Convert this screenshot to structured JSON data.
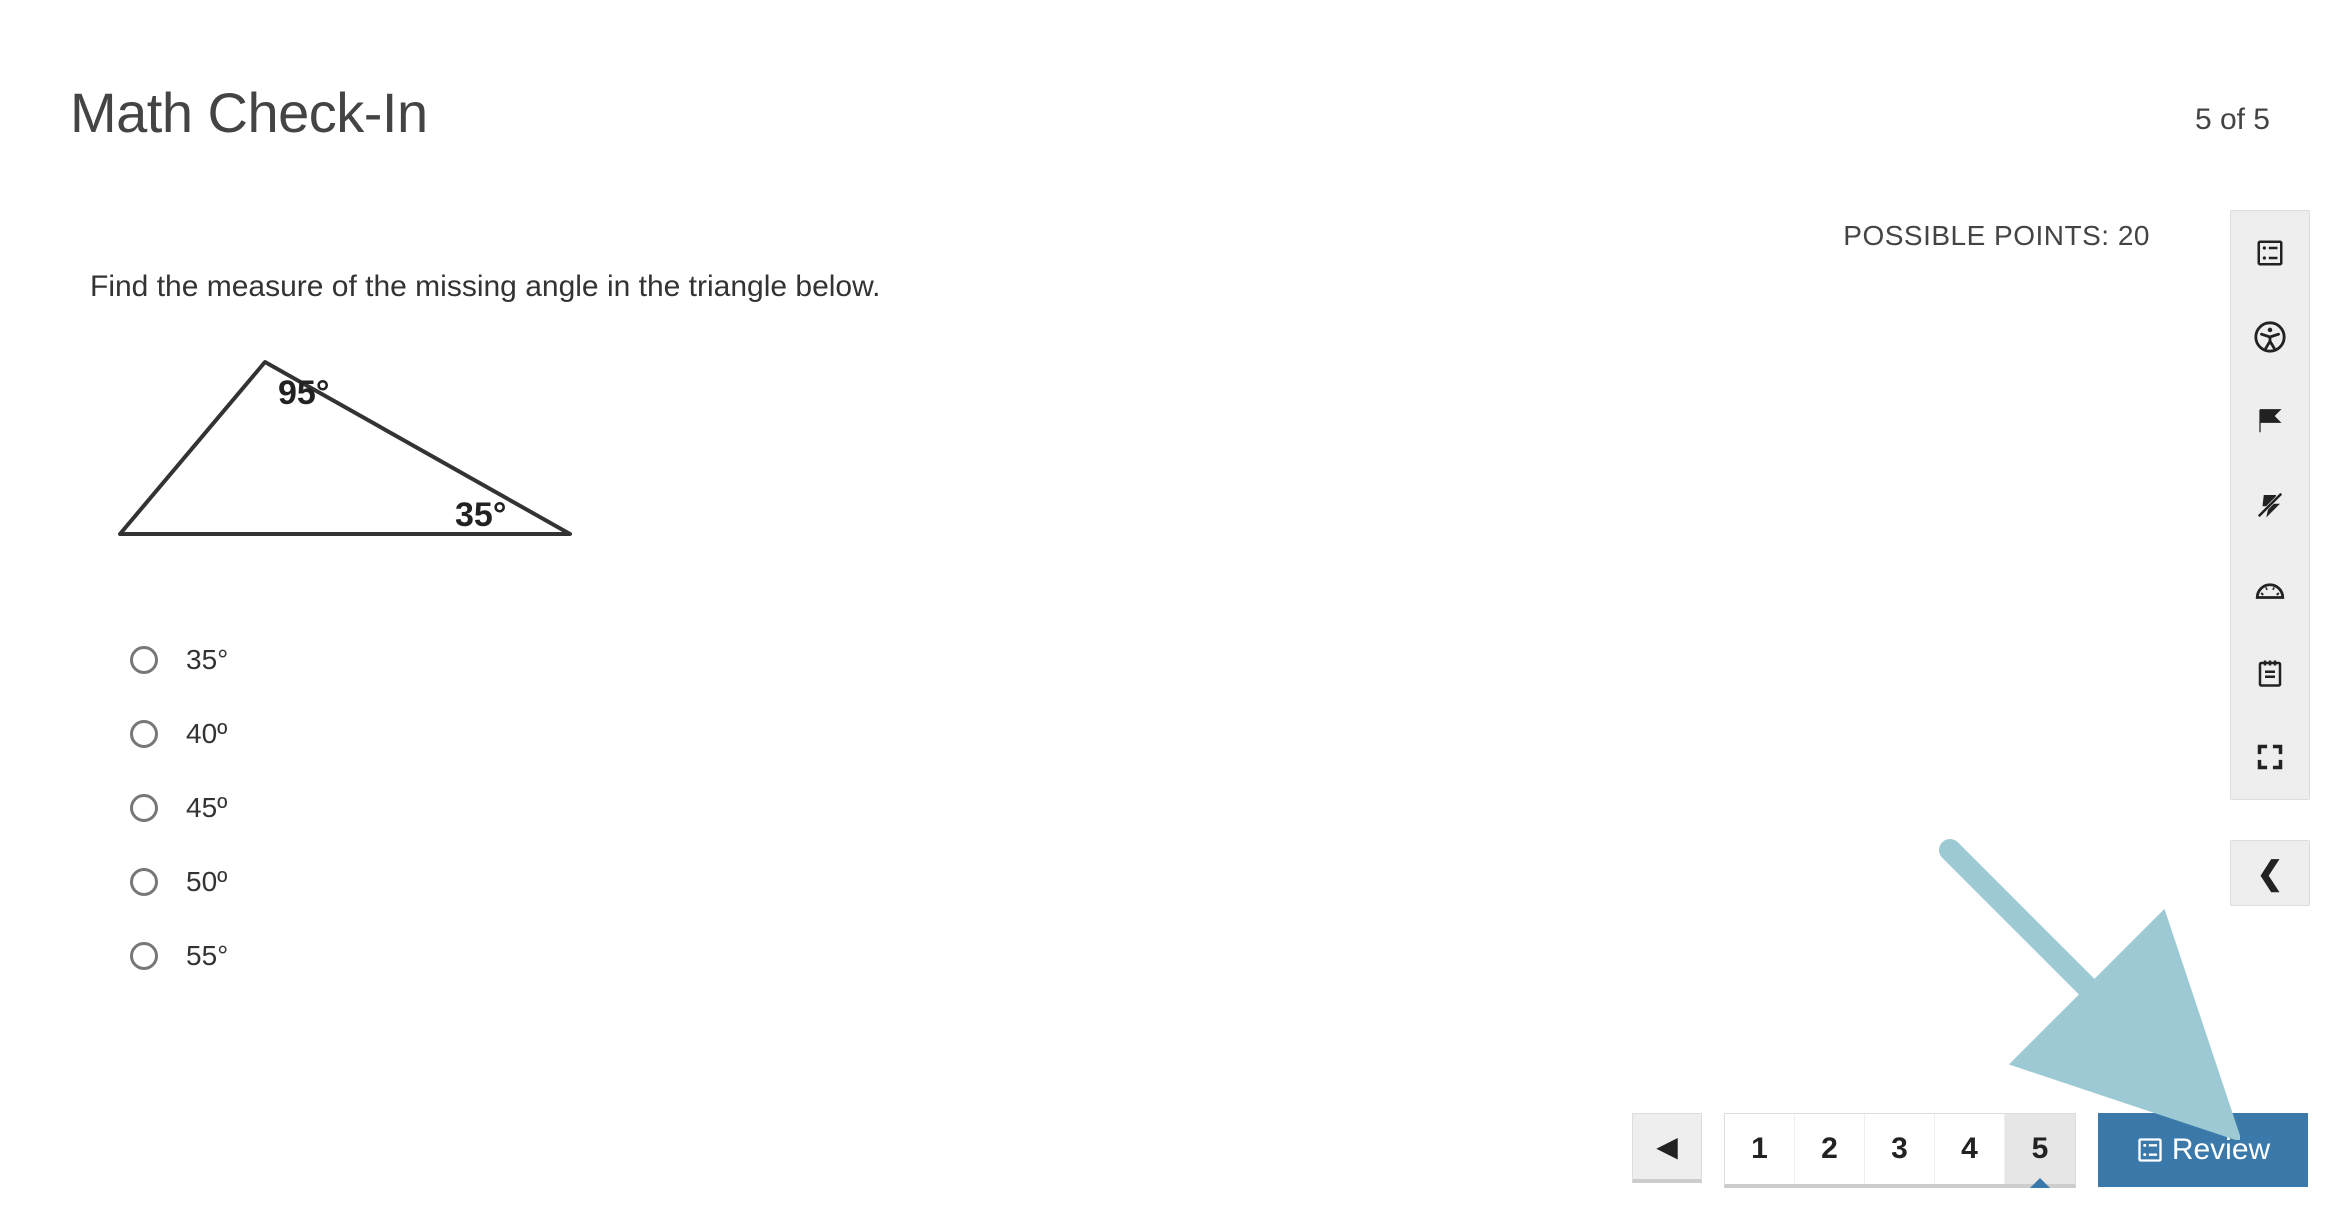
{
  "header": {
    "title": "Math Check-In",
    "counter": "5 of 5"
  },
  "points_label": "POSSIBLE POINTS: 20",
  "question": {
    "prompt": "Find the measure of the missing angle in the triangle below.",
    "triangle_angles": {
      "top": "95°",
      "right": "35°"
    },
    "options": [
      "35°",
      "40º",
      "45º",
      "50º",
      "55°"
    ]
  },
  "nav": {
    "pages": [
      "1",
      "2",
      "3",
      "4",
      "5"
    ],
    "active_index": 4,
    "review_label": "Review"
  },
  "toolbar_icons": [
    "summary-icon",
    "accessibility-icon",
    "flag-icon",
    "strike-icon",
    "protractor-icon",
    "notepad-icon",
    "fullscreen-icon"
  ]
}
